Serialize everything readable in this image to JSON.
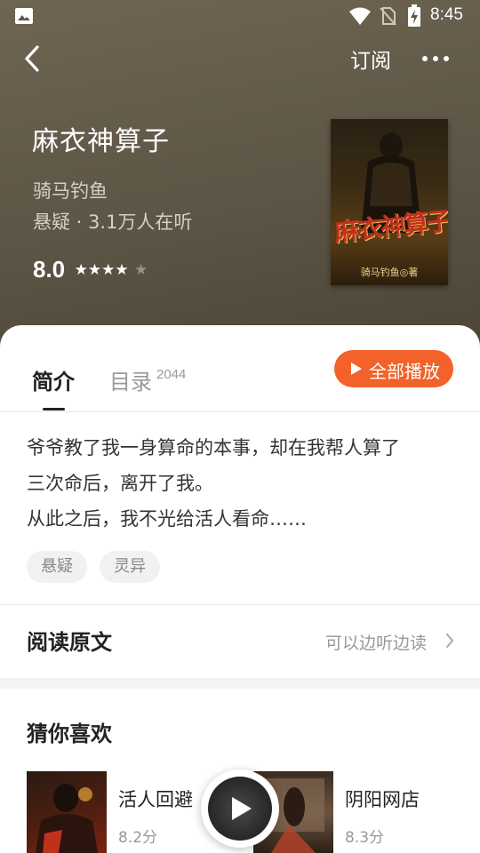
{
  "status_bar": {
    "time": "8:45"
  },
  "nav": {
    "subscribe_label": "订阅"
  },
  "book": {
    "title": "麻衣神算子",
    "author": "骑马钓鱼",
    "meta": "悬疑 · 3.1万人在听",
    "score": "8.0",
    "stars": "★★★★",
    "star_dim": "★",
    "rating_stars_filled": 4,
    "rating_stars_total": 5,
    "cover_title": "麻衣神算子",
    "cover_author": "骑马钓鱼◎著"
  },
  "tabs": {
    "intro_label": "简介",
    "toc_label": "目录",
    "toc_count": "2044",
    "play_all_label": "全部播放"
  },
  "synopsis": {
    "lines": [
      "爷爷教了我一身算命的本事，却在我帮人算了",
      "三次命后，离开了我。",
      "从此之后，我不光给活人看命……"
    ]
  },
  "tags": [
    "悬疑",
    "灵异"
  ],
  "read_original": {
    "label": "阅读原文",
    "hint": "可以边听边读"
  },
  "recommend": {
    "title": "猜你喜欢",
    "items": [
      {
        "name": "活人回避",
        "score": "8.2分"
      },
      {
        "name": "阴阳网店",
        "score": "8.3分"
      }
    ]
  },
  "colors": {
    "accent": "#f2622a",
    "hero_bg": "#5d5545"
  }
}
